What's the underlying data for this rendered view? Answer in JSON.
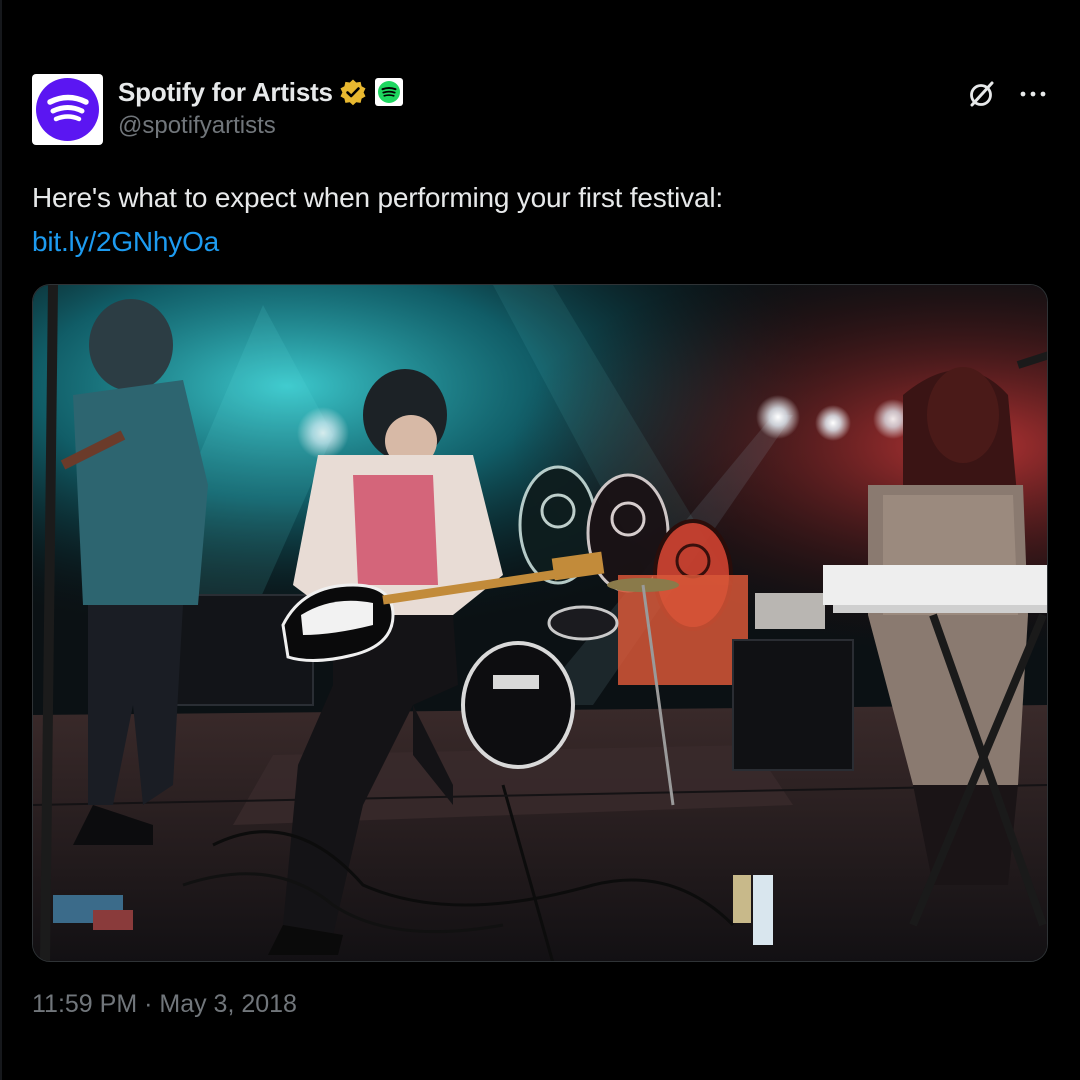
{
  "author": {
    "display_name": "Spotify for Artists",
    "handle": "@spotifyartists",
    "verified_badge_icon": "gold-verified-badge-icon",
    "affiliate_icon": "spotify-logo-icon",
    "avatar_color": "#5b16f2"
  },
  "tweet": {
    "text": "Here's what to expect when performing your first festival:",
    "link_text": "bit.ly/2GNhyOa",
    "timestamp": "11:59 PM · May 3, 2018"
  },
  "media": {
    "type": "photo",
    "subject": "band-performing-on-stage"
  },
  "header_actions": {
    "grok_icon": "grok-icon",
    "more_icon": "more-dots-icon"
  },
  "colors": {
    "background": "#000000",
    "text": "#e7e9ea",
    "secondary_text": "#71767b",
    "link": "#1d9bf0",
    "badge_gold": "#e8b830",
    "spotify_green": "#1ed760"
  }
}
